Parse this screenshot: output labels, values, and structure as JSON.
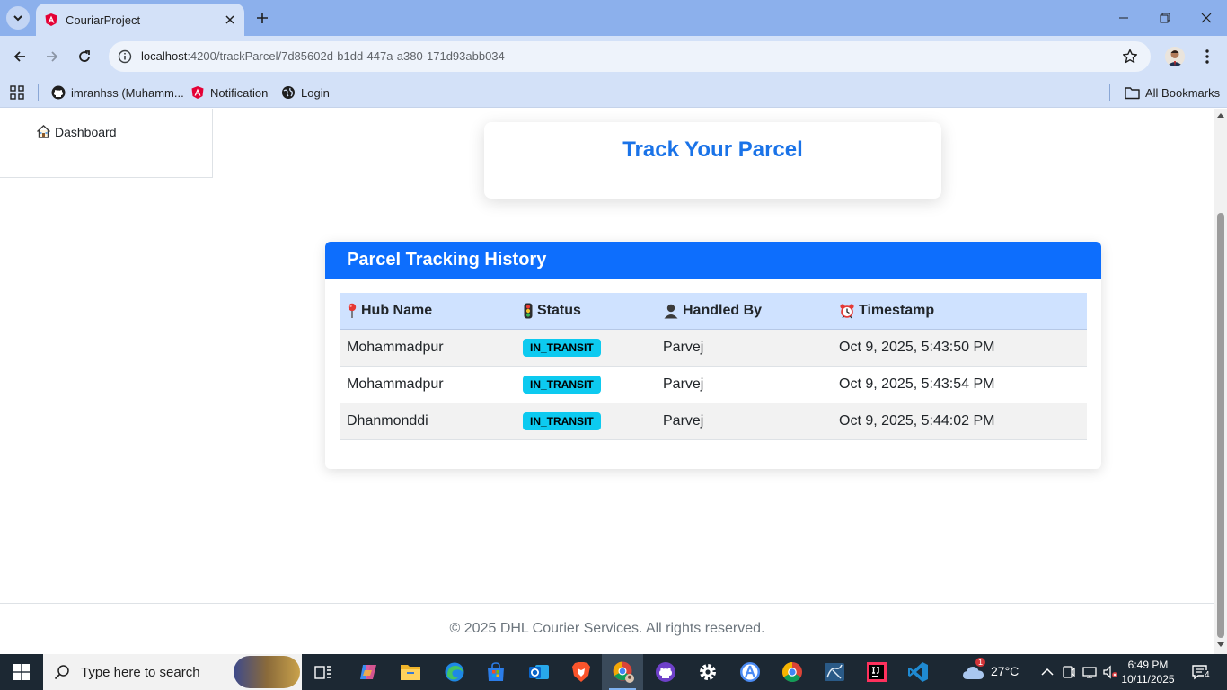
{
  "browser": {
    "tab_title": "CouriarProject",
    "url_host": "localhost",
    "url_path": ":4200/trackParcel/7d85602d-b1dd-447a-a380-171d93abb034",
    "bookmarks": [
      {
        "label": "imranhss (Muhamm...",
        "icon": "github-icon"
      },
      {
        "label": "Notification",
        "icon": "angular-icon"
      },
      {
        "label": "Login",
        "icon": "globe-icon"
      }
    ],
    "all_bookmarks_label": "All Bookmarks"
  },
  "sidebar": {
    "items": [
      {
        "label": "Dashboard",
        "icon": "home-icon"
      }
    ]
  },
  "track": {
    "title": "Track Your Parcel"
  },
  "history": {
    "title": "Parcel Tracking History",
    "columns": [
      {
        "label": "Hub Name",
        "icon": "pin-icon"
      },
      {
        "label": "Status",
        "icon": "traffic-light-icon"
      },
      {
        "label": "Handled By",
        "icon": "person-icon"
      },
      {
        "label": "Timestamp",
        "icon": "alarm-clock-icon"
      }
    ],
    "rows": [
      {
        "hub": "Mohammadpur",
        "status": "IN_TRANSIT",
        "handled_by": "Parvej",
        "timestamp": "Oct 9, 2025, 5:43:50 PM"
      },
      {
        "hub": "Mohammadpur",
        "status": "IN_TRANSIT",
        "handled_by": "Parvej",
        "timestamp": "Oct 9, 2025, 5:43:54 PM"
      },
      {
        "hub": "Dhanmonddi",
        "status": "IN_TRANSIT",
        "handled_by": "Parvej",
        "timestamp": "Oct 9, 2025, 5:44:02 PM"
      }
    ]
  },
  "footer": {
    "text": "© 2025 DHL Courier Services. All rights reserved."
  },
  "taskbar": {
    "search_placeholder": "Type here to search",
    "weather": "27°C",
    "weather_badge": "1",
    "time": "6:49 PM",
    "date": "10/11/2025",
    "notification_count": "4"
  },
  "colors": {
    "primary": "#0d6efd",
    "title_blue": "#1a73e8",
    "badge": "#0dcaf0",
    "table_header": "#cfe2ff"
  }
}
